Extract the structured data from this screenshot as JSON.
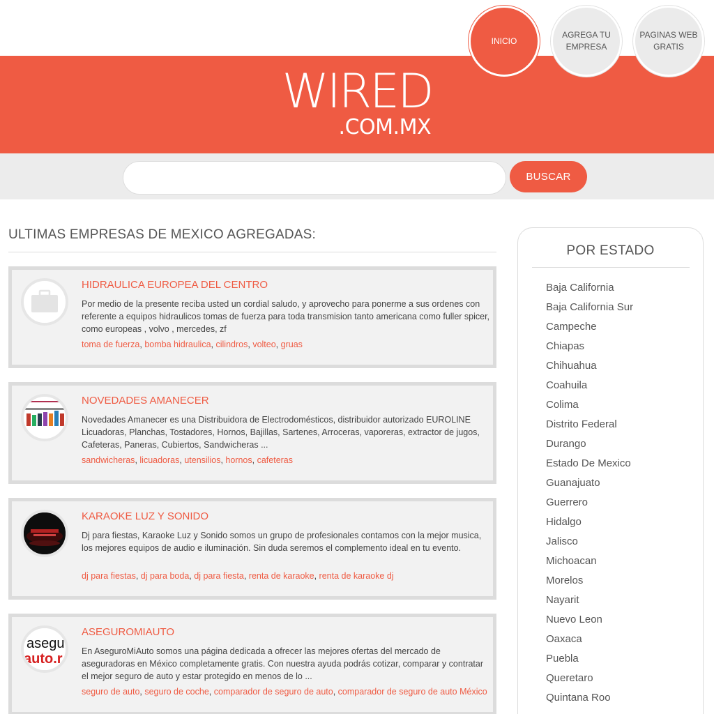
{
  "nav": {
    "items": [
      {
        "label": "INICIO",
        "active": true
      },
      {
        "label": "AGREGA TU EMPRESA",
        "active": false
      },
      {
        "label": "PAGINAS WEB GRATIS",
        "active": false
      }
    ]
  },
  "logo": {
    "main": "WIRED",
    "sub": ".COM.MX"
  },
  "search": {
    "value": "",
    "placeholder": "",
    "button_label": "BUSCAR"
  },
  "main": {
    "section_title": "ULTIMAS EMPRESAS DE MEXICO AGREGADAS:",
    "cards": [
      {
        "title": "HIDRAULICA EUROPEA DEL CENTRO",
        "description": "Por medio de la presente reciba usted un cordial saludo, y aprovecho para ponerme a sus ordenes con referente a equipos hidraulicos tomas de fuerza para toda transmision tanto americana como fuller spicer, como europeas , volvo , mercedes, zf",
        "tags": [
          "toma de fuerza",
          "bomba hidraulica",
          "cilindros",
          "volteo",
          "gruas"
        ],
        "thumb": "briefcase-icon"
      },
      {
        "title": "NOVEDADES AMANECER",
        "description": "Novedades Amanecer es una Distribuidora de Electrodomésticos, distribuidor autorizado EUROLINE Licuadoras, Planchas, Tostadores, Hornos, Bajillas, Sartenes, Arroceras, vaporeras, extractor de jugos, Cafeteras, Paneras, Cubiertos, Sandwicheras ...",
        "tags": [
          "sandwicheras",
          "licuadoras",
          "utensilios",
          "hornos",
          "cafeteras"
        ],
        "thumb": "novedades-logo"
      },
      {
        "title": "KARAOKE LUZ Y SONIDO",
        "description": "Dj para fiestas, Karaoke Luz y Sonido somos un grupo de profesionales contamos con la mejor musica, los mejores equipos de audio e iluminación. Sin duda seremos el complemento ideal en tu evento.",
        "tags": [
          "dj para fiestas",
          "dj para boda",
          "dj para fiesta",
          "renta de karaoke",
          "renta de karaoke dj"
        ],
        "thumb": "karaoke-logo"
      },
      {
        "title": "ASEGUROMIAUTO",
        "description": "En AseguroMiAuto somos una página dedicada a ofrecer las mejores ofertas del mercado de aseguradoras en México completamente gratis. Con nuestra ayuda podrás cotizar, comparar y contratar el mejor seguro de auto y estar protegido en menos de lo ...",
        "tags": [
          "seguro de auto",
          "seguro de coche",
          "comparador de seguro de auto",
          "comparador de seguro de auto México"
        ],
        "thumb": "aseguro-logo",
        "thumb_text_top": "asegu",
        "thumb_text_bottom": "auto.r"
      }
    ]
  },
  "sidebar": {
    "title": "POR ESTADO",
    "states": [
      "Baja California",
      "Baja California Sur",
      "Campeche",
      "Chiapas",
      "Chihuahua",
      "Coahuila",
      "Colima",
      "Distrito Federal",
      "Durango",
      "Estado De Mexico",
      "Guanajuato",
      "Guerrero",
      "Hidalgo",
      "Jalisco",
      "Michoacan",
      "Morelos",
      "Nayarit",
      "Nuevo Leon",
      "Oaxaca",
      "Puebla",
      "Queretaro",
      "Quintana Roo"
    ]
  },
  "colors": {
    "accent": "#ef5b43",
    "card_bg": "#f2f2f2",
    "card_border": "#dcdcdc",
    "search_band": "#ececec"
  }
}
